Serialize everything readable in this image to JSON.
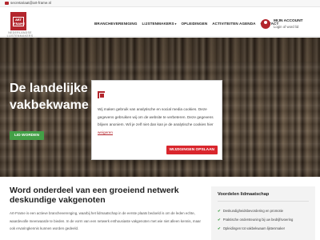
{
  "topbar": {
    "email": "secretariaat@art-frame.nl"
  },
  "logo": {
    "mark": "ART FRAME",
    "tagline": "NEDERLANDSE LIJSTENMAKERS"
  },
  "nav": [
    {
      "label": "BRANCHEVERENIGING",
      "has_caret": false
    },
    {
      "label": "LIJSTENMAKERS",
      "has_caret": true
    },
    {
      "label": "OPLEIDINGEN",
      "has_caret": false
    },
    {
      "label": "ACTIVITEITEN AGENDA",
      "has_caret": false
    },
    {
      "label": "CONTACT",
      "has_caret": false
    }
  ],
  "account": {
    "title": "MIJN ACCOUNT",
    "subtitle": "Login of word lid"
  },
  "hero": {
    "headline": "De landelijke bran\nvakbekwame lijste",
    "cta_label": "LID WORDEN"
  },
  "cookie": {
    "text": "Wij maken gebruik van analytische en social media cookies. Deze gegevens gebruiken wij om de website te verbeteren. Deze gegevens blijven anoniem. Wil je zelf niet dan kan je de analytische cookies hier",
    "link_label": "weigeren",
    "button_label": "WIJZIGINGEN OPSLAAN"
  },
  "content": {
    "heading": "Word onderdeel van een groeiend netwerk deskundige vakgenoten",
    "intro": "Art-Frame is een actieve brancheverenging, waarbij het lidmaatschap in de eerste plaats bedoeld is om de leden echte, waardevolle meerwaarde te bieden. In de vorm van een netwerk enthousiaste vakgenoten met wie niet alleen kennis, maar ook ervaringkennis kunnen worden gedeeld."
  },
  "side": {
    "title": "Voordelen lidmaatschap",
    "items": [
      "Deskundigheidsbevordering en promotie",
      "Praktische ondersteuning bij uw bedrijfsvoering",
      "Opleidingen tot vakbekwaam lijstenmaker"
    ]
  },
  "colors": {
    "brand": "#b3262d",
    "cta_green": "#43a047",
    "save_red": "#d9262d"
  }
}
